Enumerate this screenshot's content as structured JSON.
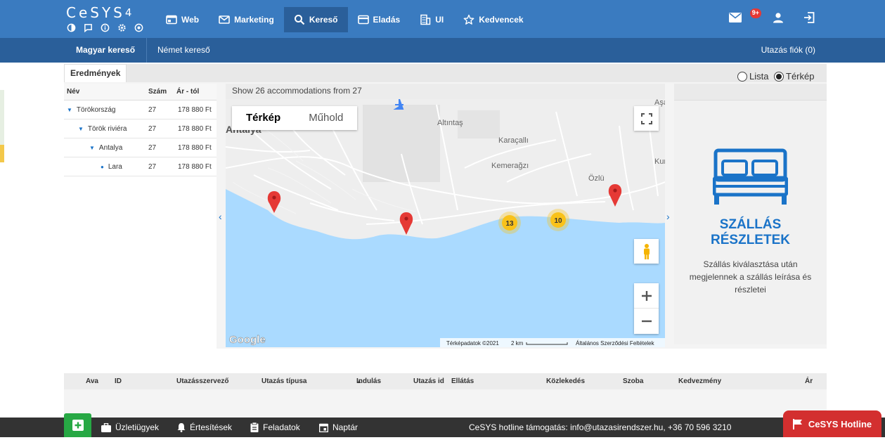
{
  "app": {
    "logo": "CeSYS",
    "logo_version": "4"
  },
  "nav": [
    {
      "label": "Web",
      "icon": "web-icon"
    },
    {
      "label": "Marketing",
      "icon": "mail-icon"
    },
    {
      "label": "Kereső",
      "icon": "search-icon",
      "active": true
    },
    {
      "label": "Eladás",
      "icon": "card-icon"
    },
    {
      "label": "UI",
      "icon": "building-icon"
    },
    {
      "label": "Kedvencek",
      "icon": "star-icon"
    }
  ],
  "top_right": {
    "mail_badge": "9+"
  },
  "subnav": {
    "tabs": [
      "Magyar kereső",
      "Német kereső"
    ],
    "account": "Utazás fiók (0)"
  },
  "results": {
    "tab_label": "Eredmények",
    "view_options": [
      "Lista",
      "Térkép"
    ],
    "selected_view": "Térkép",
    "columns": [
      "Név",
      "Szám",
      "Ár - tól"
    ],
    "rows": [
      {
        "name": "Törökország",
        "count": "27",
        "price": "178 880 Ft",
        "level": 0
      },
      {
        "name": "Török riviéra",
        "count": "27",
        "price": "178 880 Ft",
        "level": 1
      },
      {
        "name": "Antalya",
        "count": "27",
        "price": "178 880 Ft",
        "level": 2
      },
      {
        "name": "Lara",
        "count": "27",
        "price": "178 880 Ft",
        "level": 3
      }
    ]
  },
  "map": {
    "status": "Show 26 accommodations from 27",
    "type_buttons": [
      "Térkép",
      "Műhold"
    ],
    "places": [
      "Antalya",
      "Altıntaş",
      "Karaçallı",
      "Kemerağzı",
      "Özlü",
      "Kundu",
      "Aşağı"
    ],
    "clusters": [
      "13",
      "10"
    ],
    "attribution": "Térképadatok ©2021",
    "scale": "2 km",
    "terms": "Általános Szerződési Feltételek",
    "google_label": "Google"
  },
  "detail": {
    "title_line1": "SZÁLLÁS",
    "title_line2": "RÉSZLETEK",
    "text": "Szállás kiválasztása után megjelennek a szállás leírása és részletei"
  },
  "table": {
    "columns": [
      "Ava",
      "ID",
      "Utazásszervező",
      "Utazás típusa",
      "Indulás",
      "Utazás id",
      "Ellátás",
      "Közlekedés",
      "Szoba",
      "Kedvezmény",
      "Ár"
    ]
  },
  "footer": {
    "items": [
      "Üzletiügyek",
      "Értesítések",
      "Feladatok",
      "Naptár"
    ],
    "support": "CeSYS hotline támogatás: info@utazasirendszer.hu, +36 70 596 3210",
    "hotline": "CeSYS Hotline"
  },
  "colors": {
    "primary": "#3a7bc0",
    "primary_dark": "#2a5f9a",
    "accent": "#1a73c8",
    "hotline": "#d32f2f",
    "add": "#27a844",
    "water": "#aadaff",
    "cluster": "#f9c21a",
    "marker": "#e53935"
  }
}
